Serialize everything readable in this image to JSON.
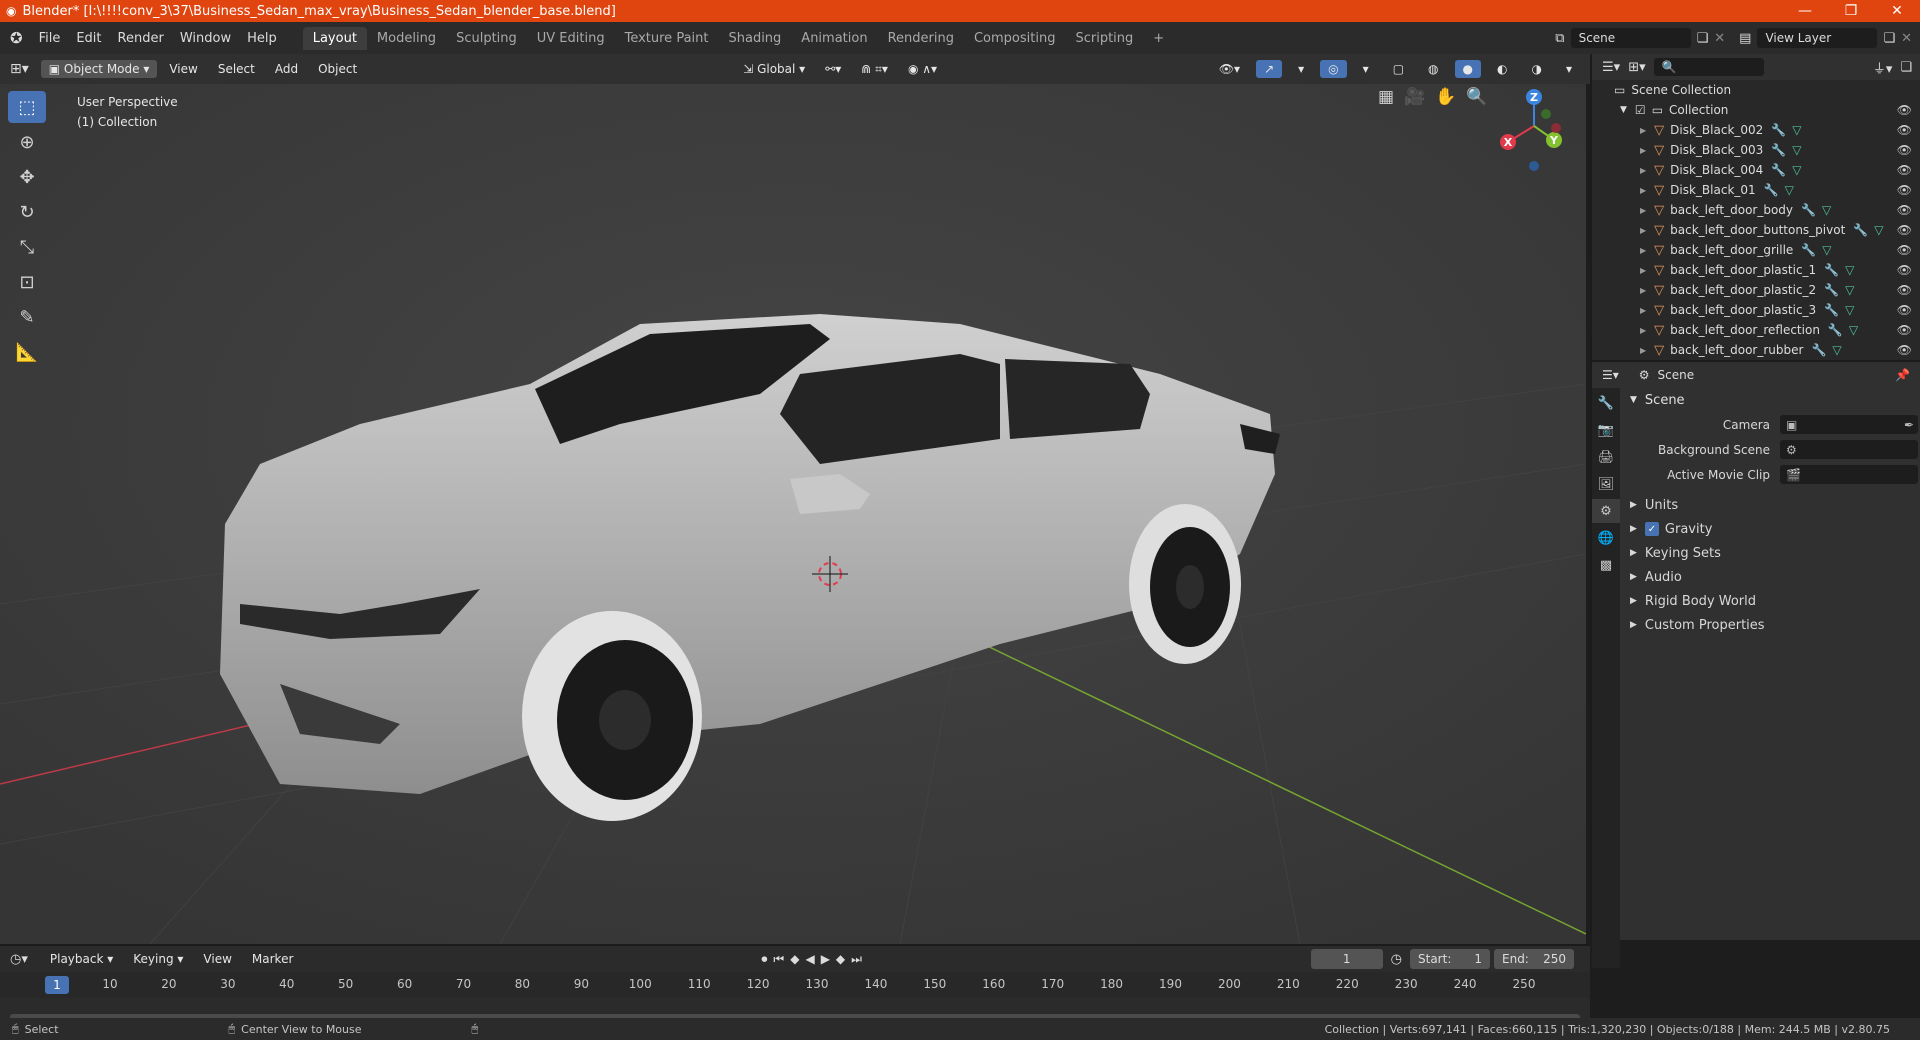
{
  "window": {
    "title": "Blender* [I:\\!!!!conv_3\\37\\Business_Sedan_max_vray\\Business_Sedan_blender_base.blend]",
    "minimize": "—",
    "maximize": "❐",
    "close": "✕"
  },
  "menu": {
    "items": [
      "File",
      "Edit",
      "Render",
      "Window",
      "Help"
    ]
  },
  "workspaces": {
    "tabs": [
      "Layout",
      "Modeling",
      "Sculpting",
      "UV Editing",
      "Texture Paint",
      "Shading",
      "Animation",
      "Rendering",
      "Compositing",
      "Scripting"
    ],
    "add": "+"
  },
  "topright": {
    "scene": "Scene",
    "view_layer": "View Layer"
  },
  "viewport_header": {
    "mode": "Object Mode",
    "menus": [
      "View",
      "Select",
      "Add",
      "Object"
    ],
    "transform_orientation": "Global"
  },
  "viewport": {
    "perspective": "User Perspective",
    "collection": "(1) Collection",
    "gizmo": {
      "x": "X",
      "y": "Y",
      "z": "Z"
    }
  },
  "outliner": {
    "root": "Scene Collection",
    "collection": "Collection",
    "items": [
      "Disk_Black_002",
      "Disk_Black_003",
      "Disk_Black_004",
      "Disk_Black_01",
      "back_left_door_body",
      "back_left_door_buttons_pivot",
      "back_left_door_grille",
      "back_left_door_plastic_1",
      "back_left_door_plastic_2",
      "back_left_door_plastic_3",
      "back_left_door_reflection",
      "back_left_door_rubber"
    ]
  },
  "properties": {
    "header": "Scene",
    "panel": "Scene",
    "camera_label": "Camera",
    "background_label": "Background Scene",
    "movie_clip_label": "Active Movie Clip",
    "sections": [
      "Units",
      "Gravity",
      "Keying Sets",
      "Audio",
      "Rigid Body World",
      "Custom Properties"
    ],
    "gravity_checked": true
  },
  "timeline": {
    "menus": [
      "Playback",
      "Keying",
      "View",
      "Marker"
    ],
    "current_frame": "1",
    "start_label": "Start:",
    "start": "1",
    "end_label": "End:",
    "end": "250",
    "ticks": [
      "1",
      "10",
      "20",
      "30",
      "40",
      "50",
      "60",
      "70",
      "80",
      "90",
      "100",
      "110",
      "120",
      "130",
      "140",
      "150",
      "160",
      "170",
      "180",
      "190",
      "200",
      "210",
      "220",
      "230",
      "240",
      "250"
    ]
  },
  "status": {
    "select": "Select",
    "center_view": "Center View to Mouse",
    "stats": "Collection | Verts:697,141 | Faces:660,115 | Tris:1,320,230 | Objects:0/188 | Mem: 244.5 MB | v2.80.75"
  },
  "colors": {
    "title_bar": "#e0450f",
    "accent": "#4772b3",
    "x_axis": "#e03a4b",
    "y_axis": "#84c12f",
    "z_axis": "#3b84e0"
  }
}
